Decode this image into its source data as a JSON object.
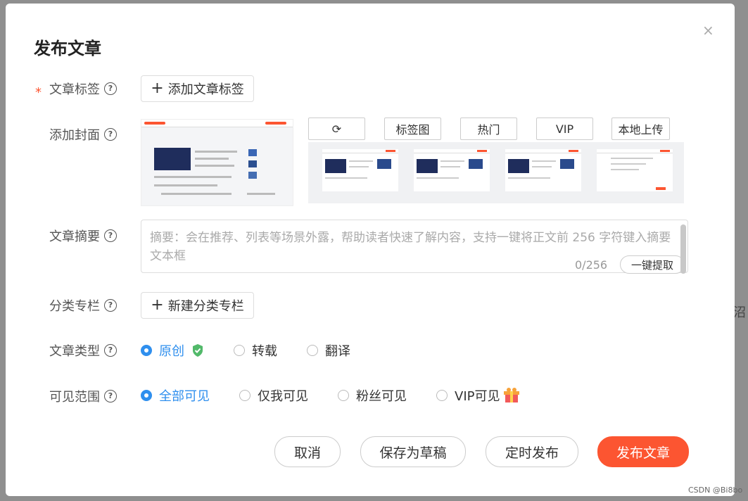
{
  "background": {
    "fragments": [
      "沼"
    ]
  },
  "dialog": {
    "title": "发布文章",
    "close_label": "×",
    "help_glyph": "?",
    "required_mark": "*"
  },
  "tags": {
    "label": "文章标签",
    "add_label": "添加文章标签"
  },
  "cover": {
    "label": "添加封面",
    "tabs": [
      "标签图",
      "热门",
      "VIP",
      "本地上传"
    ],
    "thumbnail_count": 4
  },
  "summary": {
    "label": "文章摘要",
    "placeholder": "摘要：会在推荐、列表等场景外露，帮助读者快速了解内容，支持一键将正文前 256 字符键入摘要文本框",
    "count": "0/256",
    "extract_label": "一键提取"
  },
  "category": {
    "label": "分类专栏",
    "add_label": "新建分类专栏"
  },
  "article_type": {
    "label": "文章类型",
    "options": [
      "原创",
      "转载",
      "翻译"
    ],
    "selected": "原创"
  },
  "visibility": {
    "label": "可见范围",
    "options": [
      "全部可见",
      "仅我可见",
      "粉丝可见",
      "VIP可见"
    ],
    "selected": "全部可见"
  },
  "footer": {
    "cancel_label": "取消",
    "draft_label": "保存为草稿",
    "schedule_label": "定时发布",
    "publish_label": "发布文章"
  },
  "watermark": "CSDN @Bi8bo",
  "colors": {
    "accent": "#fc5531",
    "selected_blue": "#2f8fee",
    "shield_green": "#52b96a"
  }
}
